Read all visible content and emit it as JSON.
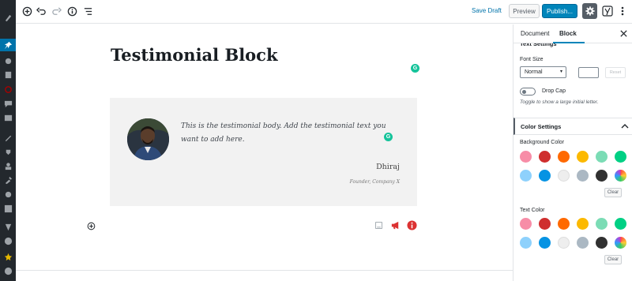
{
  "toolbar": {
    "save_draft_label": "Save Draft",
    "preview_label": "Preview",
    "publish_label": "Publish..."
  },
  "post": {
    "title": "Testimonial Block"
  },
  "testimonial": {
    "body": "This is the testimonial body. Add the testimonial text you want to add here.",
    "name": "Dhiraj",
    "role": "Founder, Company X"
  },
  "sidebar": {
    "tabs": [
      {
        "label": "Document"
      },
      {
        "label": "Block"
      }
    ],
    "text_settings": {
      "heading": "Text Settings",
      "font_size_label": "Font Size",
      "font_size_value": "Normal",
      "reset_label": "Reset",
      "drop_cap_label": "Drop Cap",
      "drop_cap_help": "Toggle to show a large initial letter."
    },
    "color_settings": {
      "heading": "Color Settings",
      "background_label": "Background Color",
      "text_label": "Text Color",
      "clear_label": "Clear",
      "swatches": [
        "#f78da7",
        "#cf2e2e",
        "#ff6900",
        "#fcb900",
        "#7bdcb5",
        "#00d084",
        "#8ed1fc",
        "#0693e3",
        "#eeeeee",
        "#abb8c3",
        "#313131",
        "gradient"
      ]
    }
  },
  "colors": {
    "wp_sidebar": "#23282d",
    "accent": "#0085ba",
    "grammarly": "#15c39a"
  }
}
